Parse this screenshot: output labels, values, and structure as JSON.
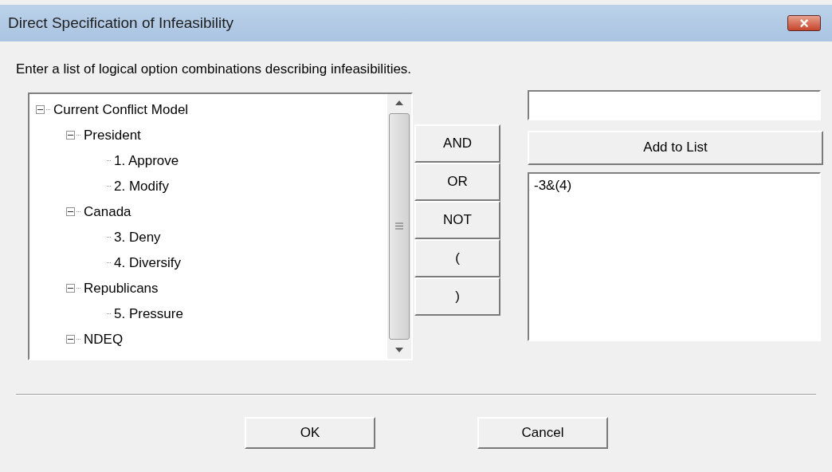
{
  "window": {
    "title": "Direct Specification of Infeasibility",
    "close": "×"
  },
  "instruction": "Enter a list of logical option combinations describing infeasibilities.",
  "tree": [
    {
      "label": "Current Conflict Model",
      "expanded": true,
      "children": [
        {
          "label": "President",
          "expanded": true,
          "children": [
            {
              "label": "1. Approve"
            },
            {
              "label": "2. Modify"
            }
          ]
        },
        {
          "label": "Canada",
          "expanded": true,
          "children": [
            {
              "label": "3. Deny"
            },
            {
              "label": "4. Diversify"
            }
          ]
        },
        {
          "label": "Republicans",
          "expanded": true,
          "children": [
            {
              "label": "5. Pressure"
            }
          ]
        },
        {
          "label": "NDEQ",
          "expanded": true
        }
      ]
    }
  ],
  "operators": [
    "AND",
    "OR",
    "NOT",
    "(",
    ")"
  ],
  "add_button": "Add to List",
  "list_items": [
    "-3&(4)"
  ],
  "buttons": [
    "OK",
    "Cancel"
  ]
}
